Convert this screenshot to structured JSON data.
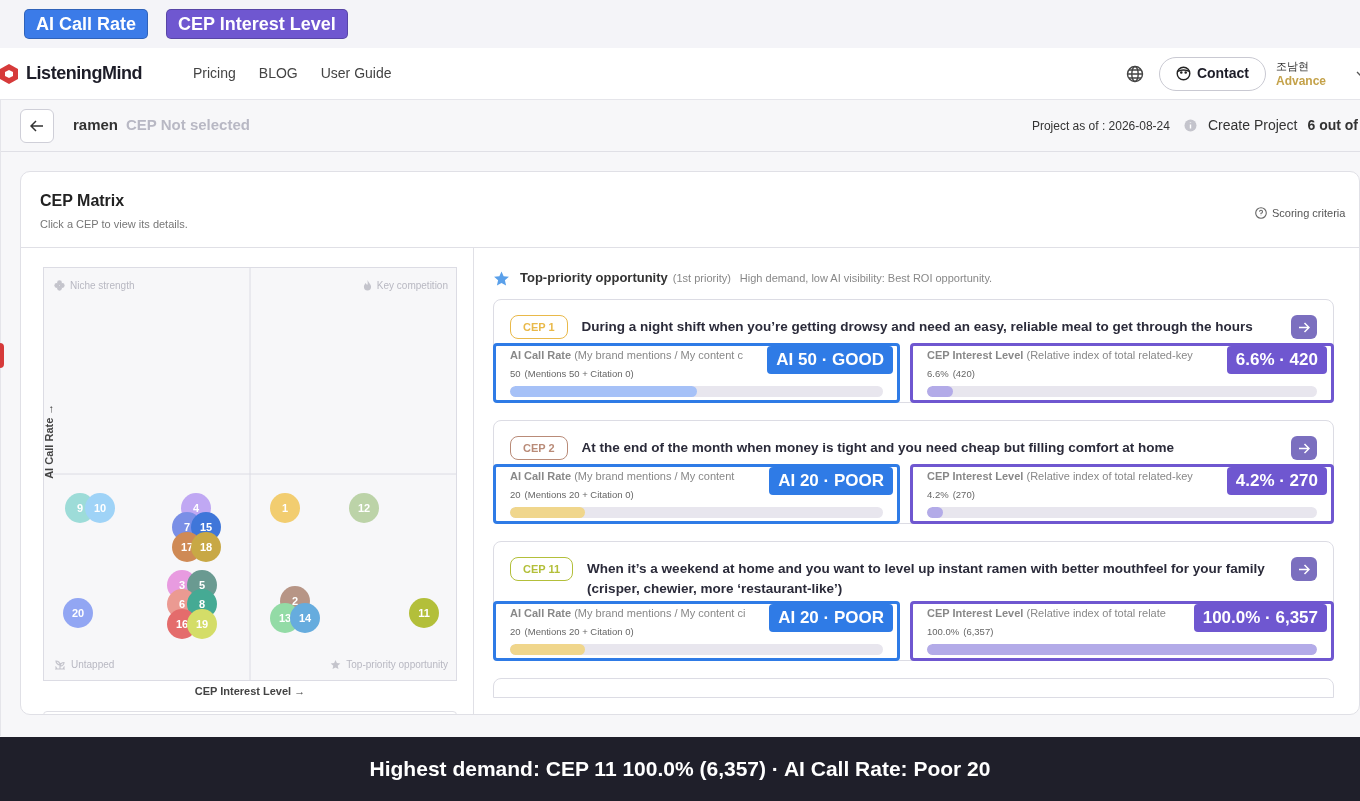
{
  "legend_badges": [
    {
      "label": "AI Call Rate",
      "color": "#3b7be8"
    },
    {
      "label": "CEP Interest Level",
      "color": "#6f57d0"
    }
  ],
  "nav": {
    "brand": "ListeningMind",
    "links": [
      "Pricing",
      "BLOG",
      "User Guide"
    ],
    "contact": "Contact",
    "user_name": "조남현",
    "user_plan": "Advance"
  },
  "project_bar": {
    "keyword": "ramen",
    "cep_state": "CEP Not selected",
    "project_as_of": "Project as of : 2026-08-24",
    "create_project": "Create Project",
    "count": "6 out of"
  },
  "matrix": {
    "title": "CEP Matrix",
    "subtitle": "Click a CEP to view its details.",
    "scoring": "Scoring criteria",
    "quadrants": [
      "Niche strength",
      "Key competition",
      "Untapped",
      "Top-priority opportunity"
    ],
    "y_axis": "AI Call Rate →",
    "x_axis": "CEP Interest Level →",
    "bubbles": [
      {
        "label": "9",
        "color": "#9ddcd8"
      },
      {
        "label": "10",
        "color": "#9fd3f7"
      },
      {
        "label": "4",
        "color": "#c0a8f3"
      },
      {
        "label": "7",
        "color": "#7a8fe6"
      },
      {
        "label": "15",
        "color": "#3f76d9"
      },
      {
        "label": "17",
        "color": "#cf8a55"
      },
      {
        "label": "18",
        "color": "#c8a845"
      },
      {
        "label": "1",
        "color": "#f2cd70"
      },
      {
        "label": "12",
        "color": "#bcd3a8"
      },
      {
        "label": "3",
        "color": "#e89be0"
      },
      {
        "label": "5",
        "color": "#6a9a91"
      },
      {
        "label": "6",
        "color": "#eb9a92"
      },
      {
        "label": "8",
        "color": "#45aa94"
      },
      {
        "label": "16",
        "color": "#e46c6c"
      },
      {
        "label": "19",
        "color": "#d4dd68"
      },
      {
        "label": "20",
        "color": "#92a6f3"
      },
      {
        "label": "2",
        "color": "#b79586"
      },
      {
        "label": "13",
        "color": "#93dba6"
      },
      {
        "label": "14",
        "color": "#66acde"
      },
      {
        "label": "11",
        "color": "#b3bf3a"
      }
    ]
  },
  "section": {
    "title": "Top-priority opportunity",
    "priority": "(1st priority)",
    "description": "High demand, low AI visibility: Best ROI opportunity."
  },
  "cards": [
    {
      "tag": "CEP 1",
      "color": "#e9b94a",
      "title": "During a night shift when you’re getting drowsy and need an easy, reliable meal to get through the hours",
      "ai_label": "AI Call Rate",
      "ai_hint": "(My brand mentions / My content c",
      "ai_value": "50",
      "ai_detail": "(Mentions 50 + Citation 0)",
      "ai_callout": "AI 50 · GOOD",
      "ai": {
        "level": 0.5,
        "color": "#a6c1f7"
      },
      "interest_label": "CEP Interest Level",
      "interest_hint": "(Relative index of total related-key",
      "interest_value": "6.6%",
      "interest_detail": "(420)",
      "interest_callout": "6.6% · 420",
      "interest": {
        "level": 0.066
      }
    },
    {
      "tag": "CEP 2",
      "color": "#b98b78",
      "title": "At the end of the month when money is tight and you need cheap but filling comfort at home",
      "ai_label": "AI Call Rate",
      "ai_hint": "(My brand mentions / My content",
      "ai_value": "20",
      "ai_detail": "(Mentions 20 + Citation 0)",
      "ai_callout": "AI 20 · POOR",
      "ai": {
        "level": 0.2,
        "color": "#f0d68c"
      },
      "interest_label": "CEP Interest Level",
      "interest_hint": "(Relative index of total related-key",
      "interest_value": "4.2%",
      "interest_detail": "(270)",
      "interest_callout": "4.2% · 270",
      "interest": {
        "level": 0.042
      }
    },
    {
      "tag": "CEP 11",
      "color": "#b3bf3a",
      "title": "When it’s a weekend at home and you want to level up instant ramen with better mouthfeel for your family (crisper, chewier, more ‘restaurant-like’)",
      "ai_label": "AI Call Rate",
      "ai_hint": "(My brand mentions / My content ci",
      "ai_value": "20",
      "ai_detail": "(Mentions 20 + Citation 0)",
      "ai_callout": "AI 20 · POOR",
      "ai": {
        "level": 0.2,
        "color": "#f0d68c"
      },
      "interest_label": "CEP Interest Level",
      "interest_hint": "(Relative index of total relate",
      "interest_value": "100.0%",
      "interest_detail": "(6,357)",
      "interest_callout": "100.0% · 6,357",
      "interest": {
        "level": 1.0
      }
    }
  ],
  "caption": "Highest demand: CEP 11 100.0% (6,357) · AI Call Rate: Poor 20"
}
